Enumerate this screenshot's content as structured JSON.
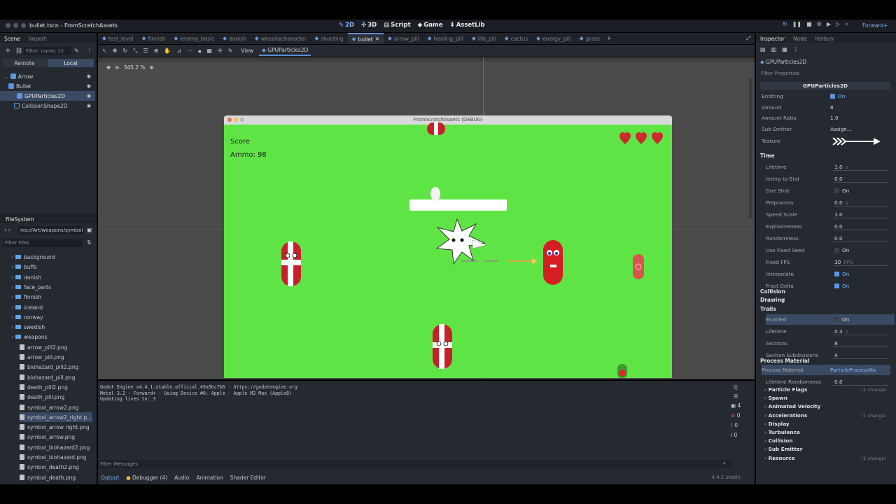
{
  "window": {
    "title": "bullet.tscn - FromScratchAssets"
  },
  "main_screens": [
    {
      "label": "2D",
      "icon": "2d-icon"
    },
    {
      "label": "3D",
      "icon": "3d-icon"
    },
    {
      "label": "Script",
      "icon": "script-icon"
    },
    {
      "label": "Game",
      "icon": "game-icon"
    },
    {
      "label": "AssetLib",
      "icon": "assetlib-icon"
    }
  ],
  "renderer": "Forward+",
  "scene_dock": {
    "tabs": [
      "Scene",
      "Import"
    ],
    "filter_placeholder": "Filter: name, t:t",
    "remote": "Remote",
    "local": "Local",
    "tree": [
      "Arrow",
      "Bullet",
      "GPUParticles2D",
      "CollisionShape2D"
    ]
  },
  "filesystem": {
    "tab": "FileSystem",
    "path": "res://Art/weapons/symbol",
    "filter_placeholder": "Filter Files",
    "folders": [
      "background",
      "buffs",
      "danish",
      "face_parts",
      "finnish",
      "iceland",
      "norway",
      "swedish",
      "weapons"
    ],
    "files": [
      "arrow_pill2.png",
      "arrow_pill.png",
      "biohazard_pill2.png",
      "biohazard_pill.png",
      "death_pill2.png",
      "death_pill.png",
      "symbol_arrow2.png",
      "symbol_arrow2_right.p...",
      "symbol_arrow right.png",
      "symbol_arrow.png",
      "symbol_biohazard2.png",
      "symbol_biohazard.png",
      "symbol_death2.png",
      "symbol_death.png"
    ]
  },
  "scene_tabs": [
    "test_level",
    "finnish",
    "enemy_basic",
    "danish",
    "wheeliecharacter",
    "shooting",
    "bullet",
    "arrow_pill",
    "healing_pill",
    "life_pill",
    "cactus",
    "energy_pill",
    "grass"
  ],
  "active_scene_tab": "bullet",
  "toolbar": {
    "view": "View",
    "node": "GPUParticles2D"
  },
  "viewport": {
    "zoom": "345.2 %"
  },
  "game": {
    "title": "FromScratchAssets (DEBUG)",
    "score_label": "Score",
    "ammo_label": "Ammo: 98",
    "lives": 3
  },
  "output": {
    "lines": [
      "Godot Engine v4.4.1.stable.official.49a5bc7b6 - https://godotengine.org",
      "Metal 3.2 - Forward+ - Using Device #0: Apple - Apple M2 Max (Apple8)",
      "",
      "Updating lives to: 3"
    ],
    "filter_placeholder": "Filter Messages",
    "counts": [
      "4",
      "0",
      "0",
      "0"
    ],
    "tabs": [
      "Output",
      "Debugger (4)",
      "Audio",
      "Animation",
      "Shader Editor"
    ],
    "version": "4.4.1.stable"
  },
  "inspector": {
    "tabs": [
      "Inspector",
      "Node",
      "History"
    ],
    "object": "GPUParticles2D",
    "filter_placeholder": "Filter Properties",
    "class_header": "GPUParticles2D",
    "props_top": [
      {
        "label": "Emitting",
        "value": "On",
        "check": true
      },
      {
        "label": "Amount",
        "value": "8"
      },
      {
        "label": "Amount Ratio",
        "value": "1.0"
      },
      {
        "label": "Sub Emitter",
        "value": "Assign..."
      },
      {
        "label": "Texture",
        "value": ""
      }
    ],
    "time_section": "Time",
    "time_props": [
      {
        "label": "Lifetime",
        "value": "1.0",
        "unit": "s"
      },
      {
        "label": "Interp to End",
        "value": "0.0"
      },
      {
        "label": "One Shot",
        "value": "On",
        "check": false
      },
      {
        "label": "Preprocess",
        "value": "0.0",
        "unit": "s"
      },
      {
        "label": "Speed Scale",
        "value": "1.0"
      },
      {
        "label": "Explosiveness",
        "value": "0.0"
      },
      {
        "label": "Randomness",
        "value": "0.0"
      },
      {
        "label": "Use Fixed Seed",
        "value": "On",
        "check": false
      },
      {
        "label": "Fixed FPS",
        "value": "30",
        "unit": "FPS"
      },
      {
        "label": "Interpolate",
        "value": "On",
        "check": true
      },
      {
        "label": "Fract Delta",
        "value": "On",
        "check": true
      }
    ],
    "sections": [
      "Collision",
      "Drawing",
      "Trails"
    ],
    "trails_props": [
      {
        "label": "Enabled",
        "value": "On",
        "check": false
      },
      {
        "label": "Lifetime",
        "value": "0.3",
        "unit": "s"
      },
      {
        "label": "Sections",
        "value": "8"
      },
      {
        "label": "Section Subdivisions",
        "value": "4"
      }
    ],
    "process_material_section": "Process Material",
    "process_material_label": "Process Material",
    "process_material_value": "ParticleProcessMa",
    "lifetime_randomness_label": "Lifetime Randomness",
    "lifetime_randomness_value": "0.0",
    "sub_sections": [
      {
        "label": "Particle Flags",
        "change": "(1 change)"
      },
      {
        "label": "Spawn",
        "change": ""
      },
      {
        "label": "Animated Velocity",
        "change": ""
      },
      {
        "label": "Accelerations",
        "change": "(1 change)"
      },
      {
        "label": "Display",
        "change": ""
      },
      {
        "label": "Turbulence",
        "change": ""
      },
      {
        "label": "Collision",
        "change": ""
      },
      {
        "label": "Sub Emitter",
        "change": ""
      },
      {
        "label": "Resource",
        "change": "(1 change)"
      }
    ]
  }
}
